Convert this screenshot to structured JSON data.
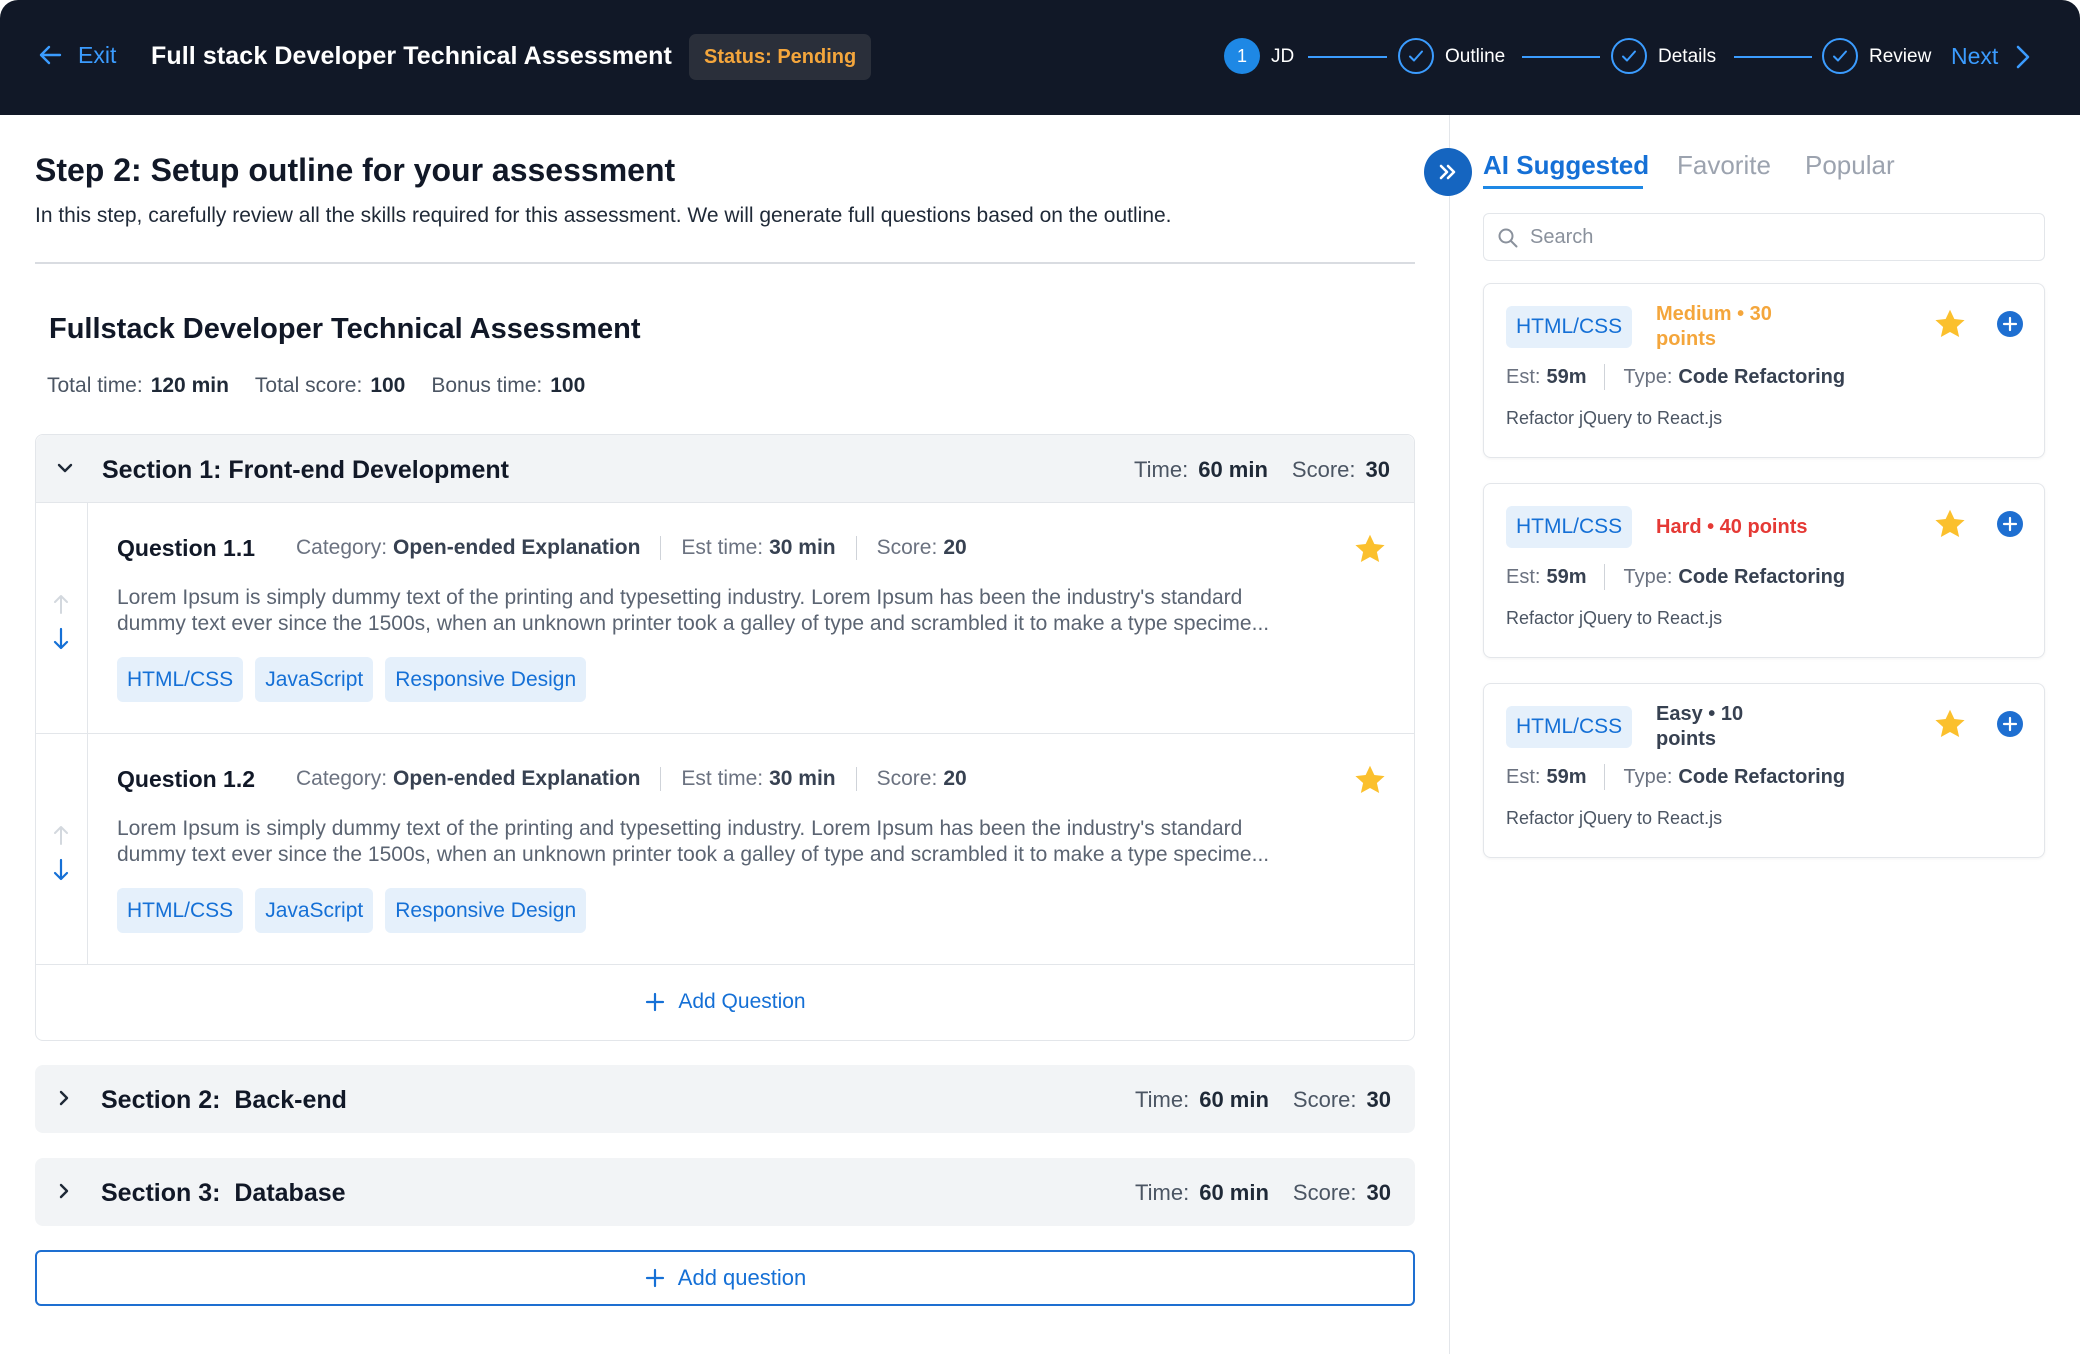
{
  "header": {
    "exit_label": "Exit",
    "title": "Full stack Developer Technical Assessment",
    "status": "Status: Pending",
    "steps": [
      {
        "label": "JD",
        "number": "1",
        "state": "active"
      },
      {
        "label": "Outline",
        "state": "done"
      },
      {
        "label": "Details",
        "state": "done"
      },
      {
        "label": "Review",
        "state": "done"
      }
    ],
    "next_label": "Next"
  },
  "main": {
    "step_title": "Step 2: Setup outline for your assessment",
    "step_desc": "In this step, carefully review all the skills required for this assessment. We will generate full questions based on the outline.",
    "assessment_title": "Fullstack Developer Technical Assessment",
    "totals": {
      "time_label": "Total time:",
      "time_value": "120 min",
      "score_label": "Total score:",
      "score_value": "100",
      "bonus_label": "Bonus time:",
      "bonus_value": "100"
    },
    "sections": [
      {
        "name": "Section 1: Front-end Development",
        "time_label": "Time:",
        "time": "60 min",
        "score_label": "Score:",
        "score": "30",
        "expanded": true,
        "questions": [
          {
            "title": "Question 1.1",
            "category_label": "Category:",
            "category": "Open-ended Explanation",
            "est_label": "Est time:",
            "est": "30 min",
            "score_label": "Score:",
            "score": "20",
            "text_line1": "Lorem Ipsum is simply dummy text of the printing and typesetting industry. Lorem Ipsum has been the industry's standard",
            "text_line2": "dummy text ever since the 1500s, when an unknown printer took a galley of type and scrambled it to make a type specime...",
            "tags": [
              "HTML/CSS",
              "JavaScript",
              "Responsive Design"
            ]
          },
          {
            "title": "Question 1.2",
            "category_label": "Category:",
            "category": "Open-ended Explanation",
            "est_label": "Est time:",
            "est": "30 min",
            "score_label": "Score:",
            "score": "20",
            "text_line1": "Lorem Ipsum is simply dummy text of the printing and typesetting industry. Lorem Ipsum has been the industry's standard",
            "text_line2": "dummy text ever since the 1500s, when an unknown printer took a galley of type and scrambled it to make a type specime...",
            "tags": [
              "HTML/CSS",
              "JavaScript",
              "Responsive Design"
            ]
          }
        ],
        "add_question_label": "Add Question"
      },
      {
        "name": "Section 2:  Back-end",
        "time_label": "Time:",
        "time": "60 min",
        "score_label": "Score:",
        "score": "30",
        "expanded": false
      },
      {
        "name": "Section 3:  Database",
        "time_label": "Time:",
        "time": "60 min",
        "score_label": "Score:",
        "score": "30",
        "expanded": false
      }
    ],
    "add_question_button": "Add question"
  },
  "side_panel": {
    "tabs": [
      "AI Suggested",
      "Favorite",
      "Popular"
    ],
    "active_tab": "AI Suggested",
    "search_placeholder": "Search",
    "suggestions": [
      {
        "tag": "HTML/CSS",
        "difficulty": "Medium • 30 points",
        "difficulty_color": "#f4a63c",
        "est_label": "Est:",
        "est": "59m",
        "type_label": "Type:",
        "type": "Code Refactoring",
        "desc": "Refactor jQuery to React.js"
      },
      {
        "tag": "HTML/CSS",
        "difficulty": "Hard • 40 points",
        "difficulty_color": "#e53935",
        "est_label": "Est:",
        "est": "59m",
        "type_label": "Type:",
        "type": "Code Refactoring",
        "desc": "Refactor jQuery to React.js"
      },
      {
        "tag": "HTML/CSS",
        "difficulty": "Easy • 10 points",
        "difficulty_color": "#374151",
        "est_label": "Est:",
        "est": "59m",
        "type_label": "Type:",
        "type": "Code Refactoring",
        "desc": "Refactor jQuery to React.js"
      }
    ]
  },
  "colors": {
    "accent": "#1e88e5",
    "header_bg": "#111827",
    "star": "#fbc02d",
    "tag_bg": "#e5f0fb"
  }
}
